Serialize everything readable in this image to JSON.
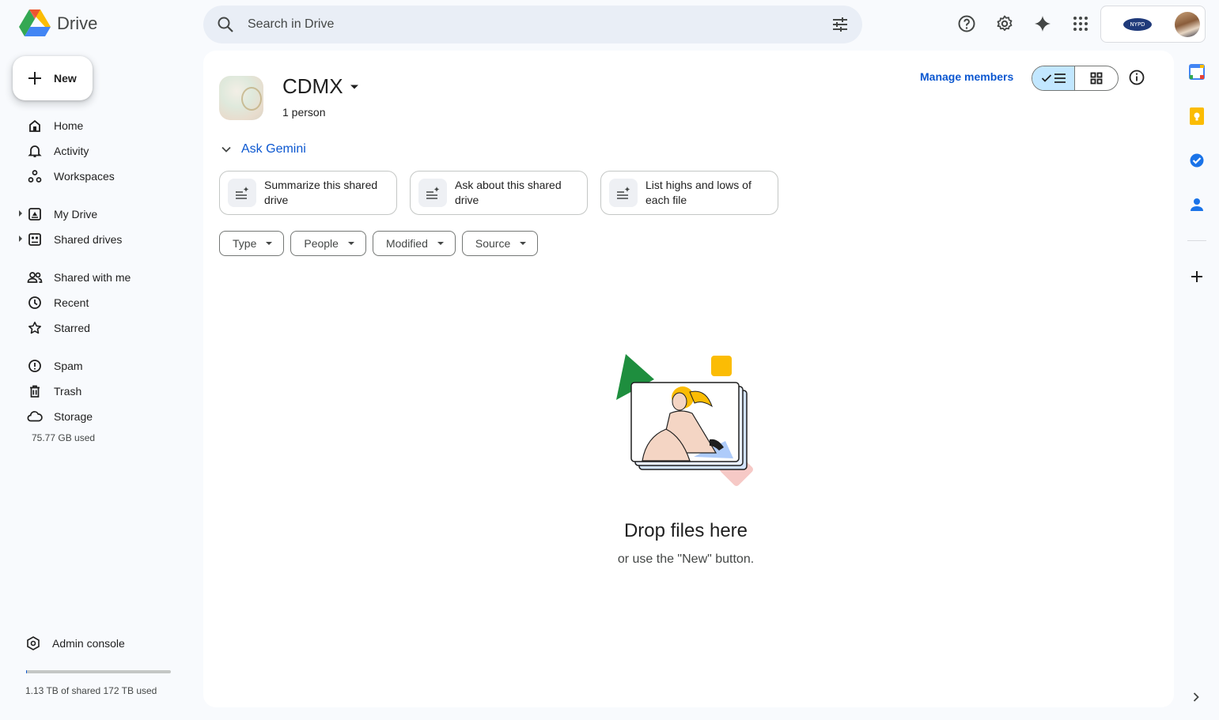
{
  "app": {
    "name": "Drive"
  },
  "search": {
    "placeholder": "Search in Drive"
  },
  "sidebar": {
    "new_label": "New",
    "items": [
      {
        "label": "Home",
        "icon": "home-icon"
      },
      {
        "label": "Activity",
        "icon": "bell-icon"
      },
      {
        "label": "Workspaces",
        "icon": "workspaces-icon"
      },
      {
        "label": "My Drive",
        "icon": "my-drive-icon"
      },
      {
        "label": "Shared drives",
        "icon": "shared-drives-icon"
      },
      {
        "label": "Shared with me",
        "icon": "people-icon"
      },
      {
        "label": "Recent",
        "icon": "clock-icon"
      },
      {
        "label": "Starred",
        "icon": "star-icon"
      },
      {
        "label": "Spam",
        "icon": "spam-icon"
      },
      {
        "label": "Trash",
        "icon": "trash-icon"
      },
      {
        "label": "Storage",
        "icon": "cloud-icon"
      }
    ],
    "storage_used": "75.77 GB used",
    "admin_label": "Admin console",
    "quota_text": "1.13 TB of shared 172 TB used",
    "quota_fraction": 0.0066
  },
  "drive": {
    "title": "CDMX",
    "subtitle": "1 person",
    "manage_members": "Manage members"
  },
  "gemini": {
    "label": "Ask Gemini",
    "chips": [
      {
        "line1": "Summarize this shared",
        "line2": "drive"
      },
      {
        "line1": "Ask about this shared",
        "line2": "drive"
      },
      {
        "line1": "List highs and lows of",
        "line2": "each file"
      }
    ]
  },
  "filters": [
    "Type",
    "People",
    "Modified",
    "Source"
  ],
  "empty": {
    "title": "Drop files here",
    "subtitle": "or use the \"New\" button."
  },
  "account": {
    "org_logo_text": "NYPD"
  },
  "colors": {
    "accent": "#0b57d0",
    "toggle_selected": "#c2e7ff",
    "background": "#f8fafd",
    "search_bg": "#e9eef6"
  }
}
